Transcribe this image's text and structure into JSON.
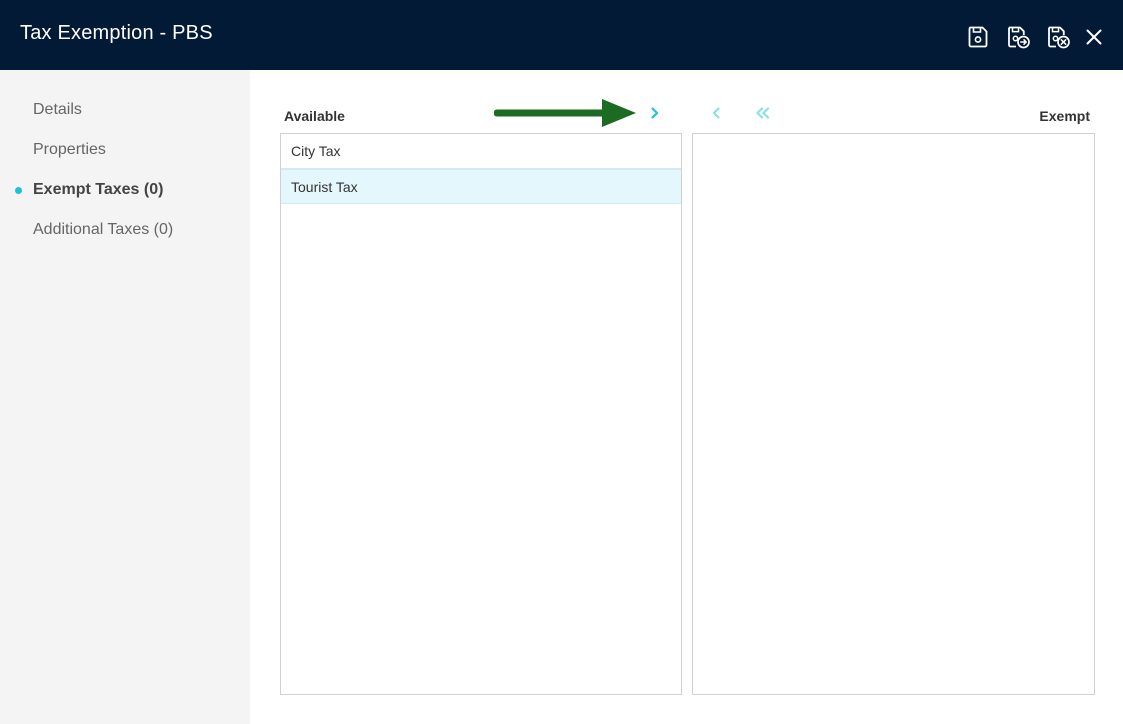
{
  "header": {
    "title": "Tax Exemption - PBS",
    "actions": [
      {
        "icon": "save-icon"
      },
      {
        "icon": "save-and-forward-icon"
      },
      {
        "icon": "save-and-close-icon"
      },
      {
        "icon": "close-icon"
      }
    ]
  },
  "sidebar": {
    "items": [
      {
        "label": "Details",
        "active": false
      },
      {
        "label": "Properties",
        "active": false
      },
      {
        "label": "Exempt Taxes (0)",
        "active": true
      },
      {
        "label": "Additional Taxes (0)",
        "active": false
      }
    ]
  },
  "transfer": {
    "available_label": "Available",
    "exempt_label": "Exempt",
    "controls": [
      {
        "icon": "chevron-right-icon",
        "action": "move-selected-to-exempt"
      },
      {
        "icon": "chevron-left-icon",
        "action": "move-selected-to-available"
      },
      {
        "icon": "double-chevron-left-icon",
        "action": "move-all-to-available"
      }
    ],
    "available_items": [
      {
        "label": "City Tax",
        "selected": false
      },
      {
        "label": "Tourist Tax",
        "selected": true
      }
    ],
    "exempt_items": []
  },
  "colors": {
    "header_bg": "#021a36",
    "accent": "#1ec2d3",
    "accent_disabled": "#8ae0ea",
    "selected_row": "#e4f7fc",
    "pointer_arrow": "#1c6b22"
  }
}
